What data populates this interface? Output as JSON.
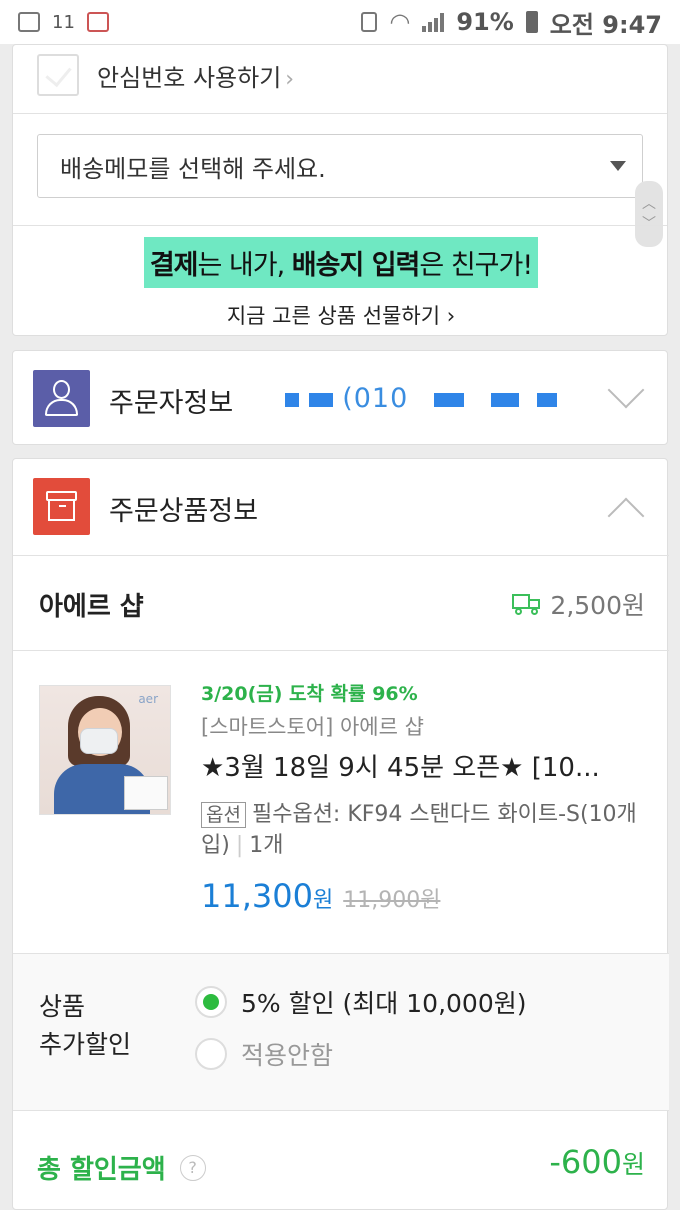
{
  "status_bar": {
    "notif_count": "11",
    "battery": "91%",
    "time": "오전 9:47"
  },
  "safe_number": {
    "label": "안심번호 사용하기",
    "chevron": "›",
    "checked": false
  },
  "delivery_memo": {
    "placeholder": "배송메모를 선택해 주세요."
  },
  "promo": {
    "part1": "결제",
    "part2": "는 내가, ",
    "part3": "배송지 입력",
    "part4": "은 친구가!",
    "link": "지금 고른 상품 선물하기 ›"
  },
  "orderer": {
    "title": "주문자정보",
    "masked_phone": "(010",
    "icon": "person-icon"
  },
  "order_products": {
    "title": "주문상품정보",
    "icon": "box-icon",
    "shop": {
      "name": "아에르 샵",
      "shipping_fee": "2,500원",
      "shipping_icon": "truck-icon"
    },
    "item": {
      "arrival": "3/20(금) 도착 확률 96%",
      "store": "[스마트스토어] 아에르 샵",
      "name": "★3월 18일 9시 45분 오픈★ [10...",
      "option_badge": "옵션",
      "option_text": "필수옵션: KF94 스탠다드 화이트-S(10개입)",
      "quantity": "1개",
      "price": "11,300",
      "price_unit": "원",
      "original_price": "11,900원",
      "thumb_brand": "aer"
    },
    "discount": {
      "label_line1": "상품",
      "label_line2": "추가할인",
      "options": [
        {
          "label": "5% 할인 (최대 10,000원)",
          "selected": true
        },
        {
          "label": "적용안함",
          "selected": false
        }
      ]
    },
    "total": {
      "label": "총 할인금액",
      "help": "?",
      "amount": "-600",
      "unit": "원"
    }
  },
  "colors": {
    "accent_green": "#2db24b",
    "price_blue": "#1b7fd6",
    "promo_mint": "#6fe8c2",
    "orderer_icon_bg": "#5b5ea8",
    "product_icon_bg": "#e24c3b"
  }
}
